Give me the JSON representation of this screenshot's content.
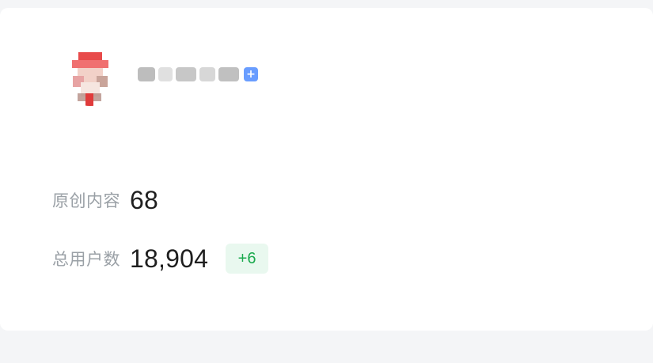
{
  "profile": {
    "avatar_icon": "avatar-icon",
    "name_redacted": "",
    "badge_icon": "plus-badge-icon",
    "badge_text": "+"
  },
  "stats": {
    "original_content_label": "原创内容",
    "original_content_value": "68",
    "total_users_label": "总用户数",
    "total_users_value": "18,904",
    "total_users_delta": "+6"
  },
  "colors": {
    "page_bg": "#f4f5f7",
    "card_bg": "#ffffff",
    "label_gray": "#9aa0a6",
    "value_dark": "#1f1f1f",
    "delta_green": "#1aa94d",
    "delta_bg": "#e9f8ef",
    "accent_blue": "#4f8cff",
    "avatar_red": "#e84a4a"
  }
}
